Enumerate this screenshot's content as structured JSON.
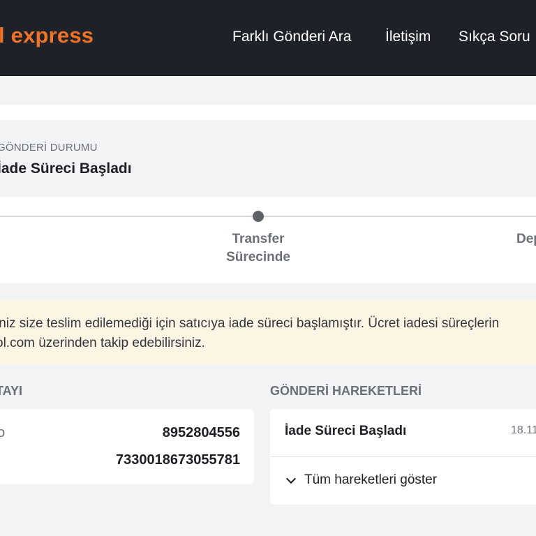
{
  "header": {
    "logo_text": "l express",
    "nav": [
      "Farklı Gönderi Ara",
      "İletişim",
      "Sıkça Soru"
    ]
  },
  "status": {
    "caption": "GÖNDERİ DURUMU",
    "title": "İade Süreci Başladı"
  },
  "progress": {
    "steps": [
      "Transfer Sürecinde",
      "Dep"
    ],
    "step_lines": [
      [
        "Transfer",
        "Sürecinde"
      ],
      [
        "Dep"
      ]
    ]
  },
  "info": {
    "line1": "iniz size teslim edilemediği için satıcıya iade süreci başlamıştır. Ücret iadesi süreçlerin",
    "line2": "ol.com üzerinden takip edebilirsiniz."
  },
  "details": {
    "section_title": "TAYI",
    "values": [
      "8952804556",
      "7330018673055781"
    ],
    "partial_label": "o"
  },
  "movements": {
    "section_title": "GÖNDERİ HAREKETLERİ",
    "items": [
      {
        "title": "İade Süreci Başladı",
        "date": "18.11."
      }
    ],
    "show_all_label": "Tüm hareketleri göster"
  },
  "colors": {
    "topbar": "#1e2128",
    "brand": "#ef7428",
    "banner": "#fdf5e4"
  }
}
